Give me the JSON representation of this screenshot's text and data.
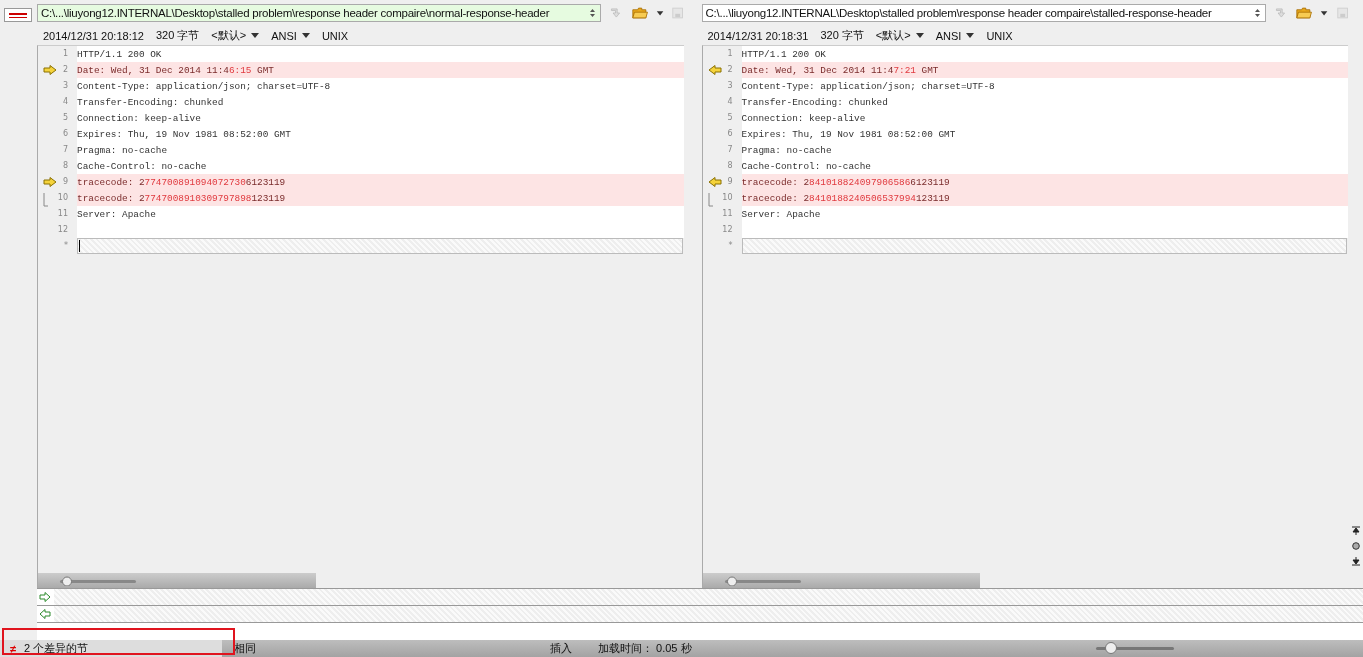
{
  "panes": [
    {
      "path": "C:\\...\\liuyong12.INTERNAL\\Desktop\\stalled problem\\response header compaire\\normal-response-header",
      "path_highlighted": true,
      "timestamp": "2014/12/31 20:18:12",
      "size": "320 字节",
      "encoding_profile": "<默认>",
      "charset": "ANSI",
      "line_ending": "UNIX",
      "arrows_point_left": false,
      "lines": [
        {
          "num": "1",
          "diff": false,
          "arrow_marker": false,
          "bracket_marker": false,
          "segments": [
            {
              "text": "HTTP/1.1 200 OK",
              "changed": false
            }
          ]
        },
        {
          "num": "2",
          "diff": true,
          "arrow_marker": true,
          "bracket_marker": false,
          "segments": [
            {
              "text": "Date: Wed, 31 Dec 2014 11:4",
              "changed": false
            },
            {
              "text": "6:15",
              "changed": true
            },
            {
              "text": " GMT",
              "changed": false
            }
          ]
        },
        {
          "num": "3",
          "diff": false,
          "arrow_marker": false,
          "bracket_marker": false,
          "segments": [
            {
              "text": "Content-Type: application/json; charset=UTF-8",
              "changed": false
            }
          ]
        },
        {
          "num": "4",
          "diff": false,
          "arrow_marker": false,
          "bracket_marker": false,
          "segments": [
            {
              "text": "Transfer-Encoding: chunked",
              "changed": false
            }
          ]
        },
        {
          "num": "5",
          "diff": false,
          "arrow_marker": false,
          "bracket_marker": false,
          "segments": [
            {
              "text": "Connection: keep-alive",
              "changed": false
            }
          ]
        },
        {
          "num": "6",
          "diff": false,
          "arrow_marker": false,
          "bracket_marker": false,
          "segments": [
            {
              "text": "Expires: Thu, 19 Nov 1981 08:52:00 GMT",
              "changed": false
            }
          ]
        },
        {
          "num": "7",
          "diff": false,
          "arrow_marker": false,
          "bracket_marker": false,
          "segments": [
            {
              "text": "Pragma: no-cache",
              "changed": false
            }
          ]
        },
        {
          "num": "8",
          "diff": false,
          "arrow_marker": false,
          "bracket_marker": false,
          "segments": [
            {
              "text": "Cache-Control: no-cache",
              "changed": false
            }
          ]
        },
        {
          "num": "9",
          "diff": true,
          "arrow_marker": true,
          "bracket_marker": false,
          "segments": [
            {
              "text": "tracecode: 2",
              "changed": false
            },
            {
              "text": "774700891094072730",
              "changed": true
            },
            {
              "text": "6123119",
              "changed": false
            }
          ]
        },
        {
          "num": "10",
          "diff": true,
          "arrow_marker": false,
          "bracket_marker": true,
          "segments": [
            {
              "text": "tracecode: 2",
              "changed": false
            },
            {
              "text": "7747008910309797898",
              "changed": true
            },
            {
              "text": "123119",
              "changed": false
            }
          ]
        },
        {
          "num": "11",
          "diff": false,
          "arrow_marker": false,
          "bracket_marker": false,
          "segments": [
            {
              "text": "Server: Apache",
              "changed": false
            }
          ]
        },
        {
          "num": "12",
          "diff": false,
          "arrow_marker": false,
          "bracket_marker": false
        }
      ],
      "new_line_mark": "*",
      "cursor": true
    },
    {
      "path": "C:\\...\\liuyong12.INTERNAL\\Desktop\\stalled problem\\response header compaire\\stalled-response-header",
      "path_highlighted": false,
      "timestamp": "2014/12/31 20:18:31",
      "size": "320 字节",
      "encoding_profile": "<默认>",
      "charset": "ANSI",
      "line_ending": "UNIX",
      "arrows_point_left": true,
      "lines": [
        {
          "num": "1",
          "diff": false,
          "arrow_marker": false,
          "bracket_marker": false,
          "segments": [
            {
              "text": "HTTP/1.1 200 OK",
              "changed": false
            }
          ]
        },
        {
          "num": "2",
          "diff": true,
          "arrow_marker": true,
          "bracket_marker": false,
          "segments": [
            {
              "text": "Date: Wed, 31 Dec 2014 11:4",
              "changed": false
            },
            {
              "text": "7:21",
              "changed": true
            },
            {
              "text": " GMT",
              "changed": false
            }
          ]
        },
        {
          "num": "3",
          "diff": false,
          "arrow_marker": false,
          "bracket_marker": false,
          "segments": [
            {
              "text": "Content-Type: application/json; charset=UTF-8",
              "changed": false
            }
          ]
        },
        {
          "num": "4",
          "diff": false,
          "arrow_marker": false,
          "bracket_marker": false,
          "segments": [
            {
              "text": "Transfer-Encoding: chunked",
              "changed": false
            }
          ]
        },
        {
          "num": "5",
          "diff": false,
          "arrow_marker": false,
          "bracket_marker": false,
          "segments": [
            {
              "text": "Connection: keep-alive",
              "changed": false
            }
          ]
        },
        {
          "num": "6",
          "diff": false,
          "arrow_marker": false,
          "bracket_marker": false,
          "segments": [
            {
              "text": "Expires: Thu, 19 Nov 1981 08:52:00 GMT",
              "changed": false
            }
          ]
        },
        {
          "num": "7",
          "diff": false,
          "arrow_marker": false,
          "bracket_marker": false,
          "segments": [
            {
              "text": "Pragma: no-cache",
              "changed": false
            }
          ]
        },
        {
          "num": "8",
          "diff": false,
          "arrow_marker": false,
          "bracket_marker": false,
          "segments": [
            {
              "text": "Cache-Control: no-cache",
              "changed": false
            }
          ]
        },
        {
          "num": "9",
          "diff": true,
          "arrow_marker": true,
          "bracket_marker": false,
          "segments": [
            {
              "text": "tracecode: 2",
              "changed": false
            },
            {
              "text": "841018824097906586",
              "changed": true
            },
            {
              "text": "6123119",
              "changed": false
            }
          ]
        },
        {
          "num": "10",
          "diff": true,
          "arrow_marker": false,
          "bracket_marker": true,
          "segments": [
            {
              "text": "tracecode: 2",
              "changed": false
            },
            {
              "text": "8410188240506537994",
              "changed": true
            },
            {
              "text": "123119",
              "changed": false
            }
          ]
        },
        {
          "num": "11",
          "diff": false,
          "arrow_marker": false,
          "bracket_marker": false,
          "segments": [
            {
              "text": "Server: Apache",
              "changed": false
            }
          ]
        },
        {
          "num": "12",
          "diff": false,
          "arrow_marker": false,
          "bracket_marker": false
        }
      ],
      "new_line_mark": "*",
      "cursor": false
    }
  ],
  "status_bar": {
    "diff_icon": "≠",
    "diff_count": "2 个差异的节",
    "compare_state": "相同",
    "insert_mode": "插入",
    "load_time": "加载时间： 0.05 秒",
    "zoom": {
      "level": 0.12
    }
  },
  "annotation_highlight": true
}
